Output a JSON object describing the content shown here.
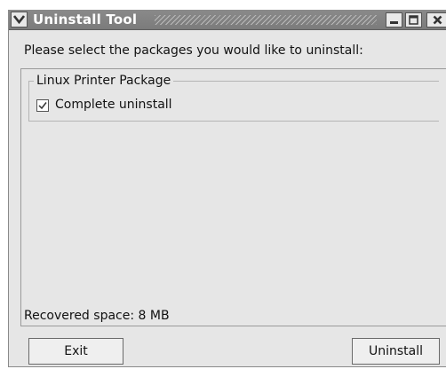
{
  "window": {
    "title": "Uninstall Tool",
    "buttons": {
      "menu": "chevron-down-icon",
      "minimize": "minimize-icon",
      "maximize": "maximize-icon",
      "close": "close-icon"
    },
    "titlebar_color": "#7f7f7f"
  },
  "prompt": "Please select the packages you would like to uninstall:",
  "package": {
    "name": "Linux Printer Package",
    "option_label": "Complete uninstall",
    "checked": true
  },
  "status": {
    "recovered_space": "Recovered space:  8 MB"
  },
  "actions": {
    "exit_label": "Exit",
    "uninstall_label": "Uninstall"
  }
}
